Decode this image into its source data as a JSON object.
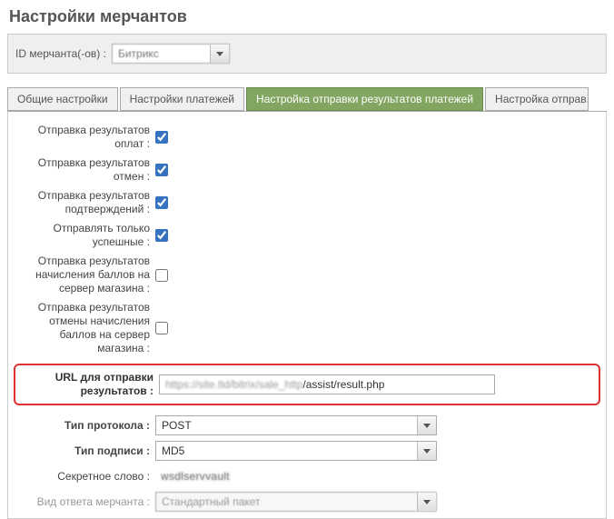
{
  "page_title": "Настройки мерчантов",
  "merchant_id": {
    "label": "ID мерчанта(-ов) :",
    "value": "Битрикс"
  },
  "tabs": [
    {
      "label": "Общие настройки",
      "active": false
    },
    {
      "label": "Настройки платежей",
      "active": false
    },
    {
      "label": "Настройка отправки результатов платежей",
      "active": true
    },
    {
      "label": "Настройка отправ...",
      "active": false
    }
  ],
  "form": {
    "send_pay_results": {
      "label": "Отправка результатов оплат :",
      "checked": true
    },
    "send_cancel_results": {
      "label": "Отправка результатов отмен :",
      "checked": true
    },
    "send_confirm_results": {
      "label": "Отправка результатов подтверждений :",
      "checked": true
    },
    "send_only_success": {
      "label": "Отправлять только успешные :",
      "checked": true
    },
    "send_points_accrual": {
      "label": "Отправка результатов начисления баллов на сервер магазина :",
      "checked": false
    },
    "send_points_cancel": {
      "label": "Отправка результатов отмены начисления баллов на сервер магазина :",
      "checked": false
    },
    "url": {
      "label": "URL для отправки результатов :",
      "value_hidden": "https://site.tld/bitrix/sale_http",
      "value_visible": "/assist/result.php"
    },
    "protocol": {
      "label": "Тип протокола :",
      "value": "POST"
    },
    "signature": {
      "label": "Тип подписи :",
      "value": "MD5"
    },
    "secret": {
      "label": "Секретное слово :",
      "value": "wsdlservvault"
    },
    "response_kind": {
      "label": "Вид ответа мерчанта :",
      "value": "Стандартный пакет"
    }
  }
}
